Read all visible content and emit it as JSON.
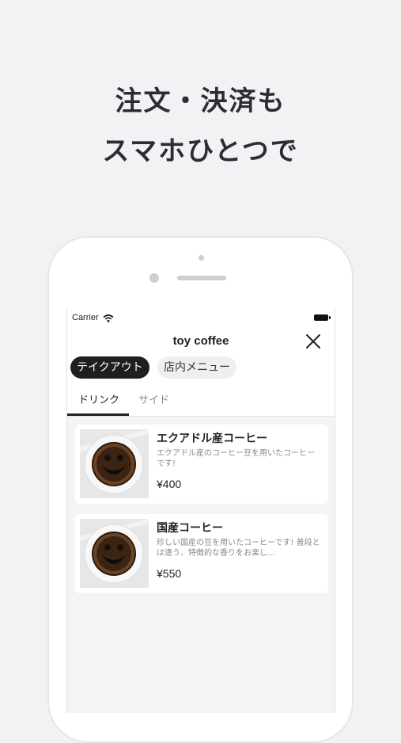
{
  "headline": {
    "line1": "注文・決済も",
    "line2": "スマホひとつで"
  },
  "status_bar": {
    "carrier": "Carrier"
  },
  "header": {
    "title": "toy coffee",
    "close_icon": "close-icon"
  },
  "mode_pills": [
    {
      "label": "テイクアウト",
      "active": true
    },
    {
      "label": "店内メニュー",
      "active": false
    }
  ],
  "tabs": [
    {
      "label": "ドリンク",
      "active": true
    },
    {
      "label": "サイド",
      "active": false
    }
  ],
  "menu_items": [
    {
      "name": "エクアドル産コーヒー",
      "description": "エクアドル産のコーヒー豆を用いたコーヒーです!",
      "price": "¥400",
      "image_icon": "coffee-cup-image"
    },
    {
      "name": "国産コーヒー",
      "description": "珍しい国産の豆を用いたコーヒーです! 普段とは違う、特徴的な香りをお楽し…",
      "price": "¥550",
      "image_icon": "coffee-cup-image"
    }
  ],
  "colors": {
    "background": "#f2f2f4",
    "active_pill": "#1f1f1f",
    "headline": "#2b2d33"
  }
}
